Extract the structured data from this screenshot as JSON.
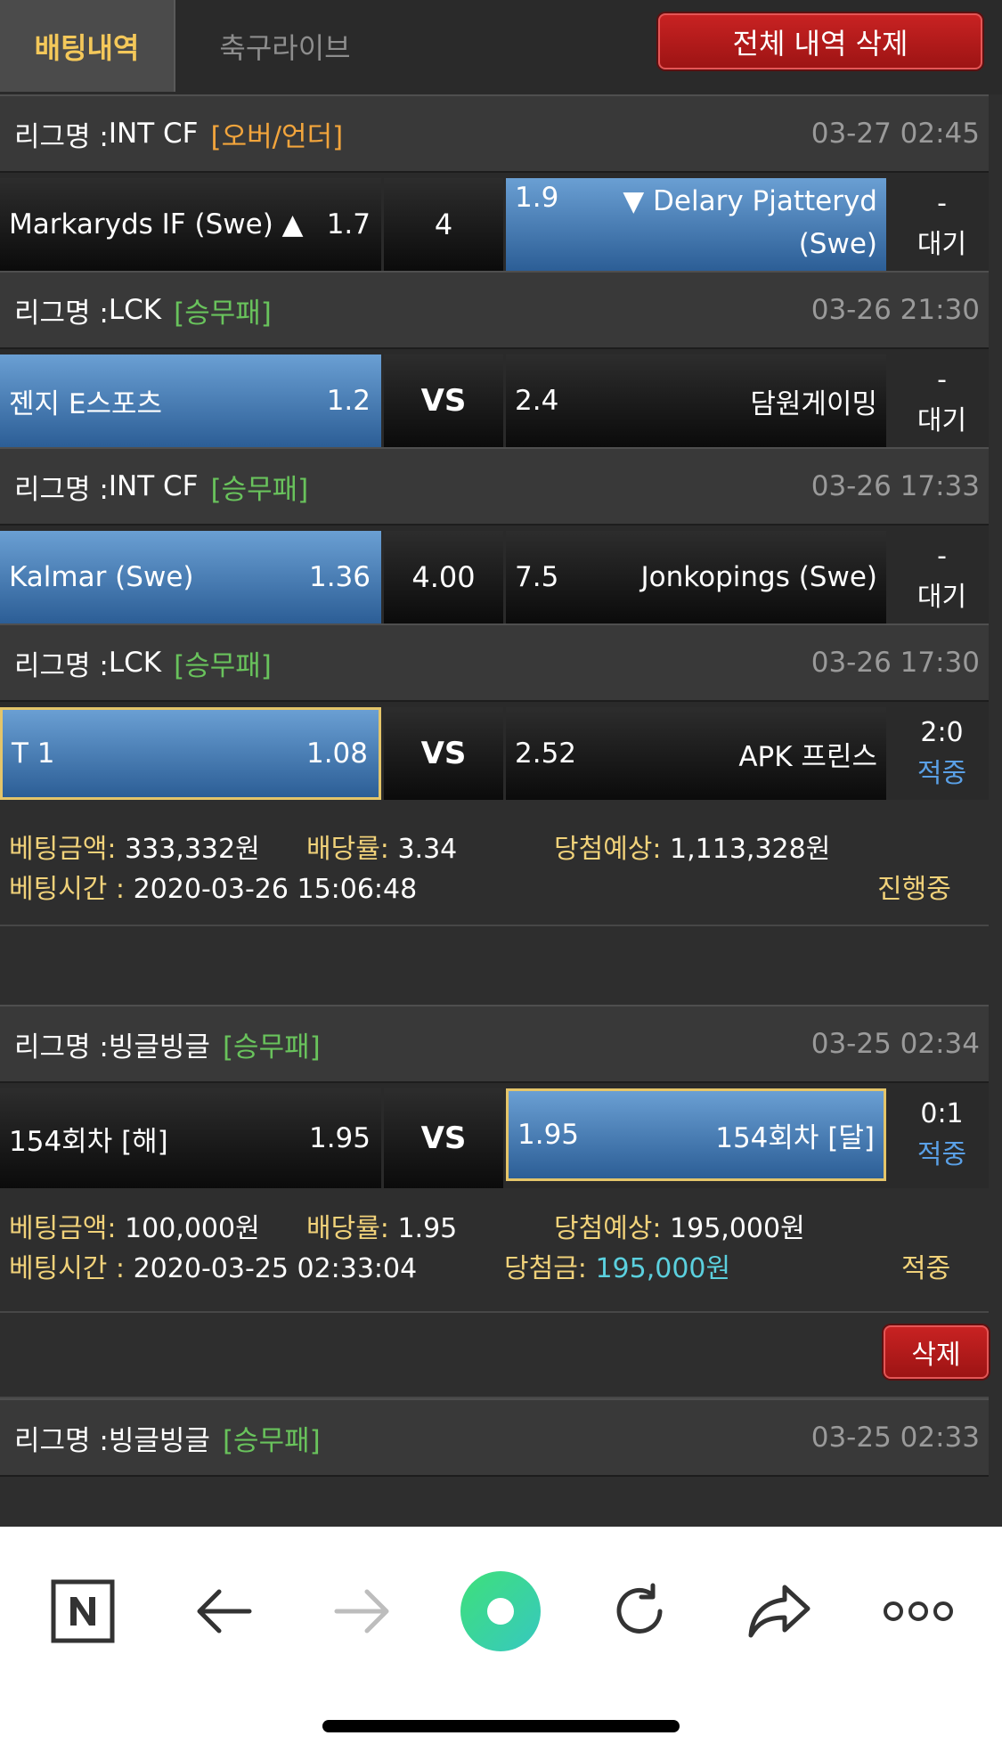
{
  "tabs": {
    "betting": "배팅내역",
    "live": "축구라이브"
  },
  "clear_all_label": "전체 내역 삭제",
  "league_prefix": "리그명 : ",
  "labels": {
    "amount": "베팅금액: ",
    "odds": "배당률: ",
    "expected": "당첨예상: ",
    "time": "베팅시간 : ",
    "winnings": "당첨금: "
  },
  "delete_label": "삭제",
  "matches": [
    {
      "league": "INT CF",
      "type": "[오버/언더]",
      "time": "03-27 02:45",
      "home": "Markaryds IF (Swe) ▲",
      "home_odd": "1.7",
      "mid": "4",
      "away_odd": "1.9",
      "away": "▼ Delary Pjatteryd (Swe)",
      "res1": "-",
      "res2": "대기"
    },
    {
      "league": "LCK",
      "type": "[승무패]",
      "time": "03-26 21:30",
      "home": "젠지 E스포츠",
      "home_odd": "1.2",
      "mid": "VS",
      "away_odd": "2.4",
      "away": "담원게이밍",
      "res1": "-",
      "res2": "대기"
    },
    {
      "league": "INT CF",
      "type": "[승무패]",
      "time": "03-26 17:33",
      "home": "Kalmar (Swe)",
      "home_odd": "1.36",
      "mid": "4.00",
      "away_odd": "7.5",
      "away": "Jonkopings (Swe)",
      "res1": "-",
      "res2": "대기"
    },
    {
      "league": "LCK",
      "type": "[승무패]",
      "time": "03-26 17:30",
      "home": "T 1",
      "home_odd": "1.08",
      "mid": "VS",
      "away_odd": "2.52",
      "away": "APK 프린스",
      "res1": "2:0",
      "res2": "적중"
    },
    {
      "league": "빙글빙글",
      "type": "[승무패]",
      "time": "03-25 02:34",
      "home": "154회차 [해]",
      "home_odd": "1.95",
      "mid": "VS",
      "away_odd": "1.95",
      "away": "154회차 [달]",
      "res1": "0:1",
      "res2": "적중"
    },
    {
      "league": "빙글빙글",
      "type": "[승무패]",
      "time": "03-25 02:33"
    }
  ],
  "slips": [
    {
      "amount": "333,332원",
      "odds": "3.34",
      "expected": "1,113,328원",
      "time": "2020-03-26 15:06:48",
      "status": "진행중"
    },
    {
      "amount": "100,000원",
      "odds": "1.95",
      "expected": "195,000원",
      "time": "2020-03-25 02:33:04",
      "winnings": "195,000원",
      "status": "적중"
    }
  ],
  "bottom_nav": [
    "naver-icon",
    "back-arrow-icon",
    "forward-arrow-icon",
    "green-dot-icon",
    "refresh-icon",
    "share-icon",
    "more-icon"
  ],
  "colors": {
    "accent_yellow": "#f1d27a",
    "wdl_green": "#69c35c",
    "ou_orange": "#f3a53c",
    "selected_blue": "#4a82bf",
    "delete_red": "#b31b1b"
  }
}
